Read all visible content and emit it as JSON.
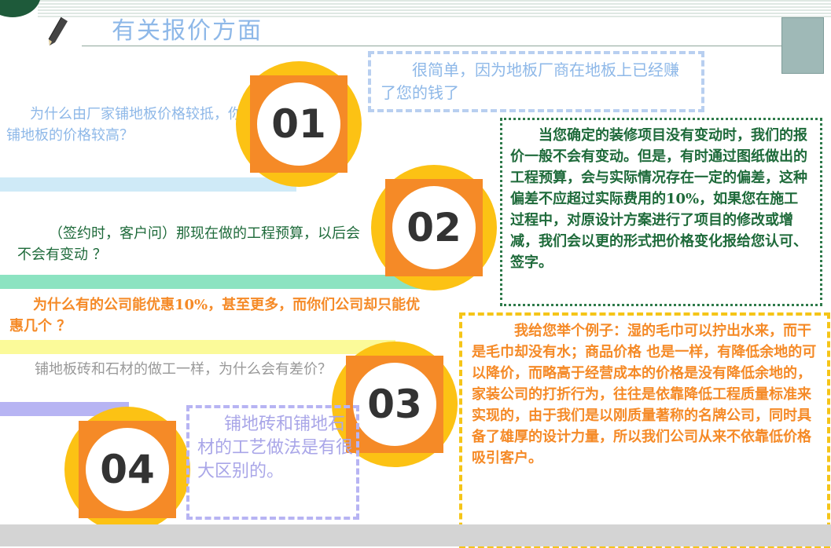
{
  "title": "有关报价方面",
  "items": [
    {
      "number": "01",
      "question": "为什么由厂家铺地板价格较抵，你们铺地板的价格较高？",
      "answer": "很简单，因为地板厂商在地板上已经赚了您的钱了"
    },
    {
      "number": "02",
      "question": "（签约时，客户问）那现在做的工程预算，以后会不会有变动 ？",
      "answer": "当您确定的装修项目没有变动时，我们的报价一般不会有变动。但是，有时通过图纸做出的工程预算，会与实际情况存在一定的偏差，这种偏差不应超过实际费用的10%，如果您在施工过程中，对原设计方案进行了项目的修改或增减，我们会以更的形式把价格变化报给您认可、签字。"
    },
    {
      "number": "03",
      "question": "为什么有的公司能优惠10%，甚至更多，而你们公司却只能优惠几个 ？",
      "answer": "我给您举个例子：湿的毛巾可以拧出水来，而干是毛巾却没有水；商品价格 也是一样，有降低余地的可以降价，而略高于经营成本的价格是没有降低余地的，家装公司的打折行为，往往是依靠降低工程质量标准来实现的，由于我们是以刚质量著称的名牌公司，同时具备了雄厚的设计力量，所以我们公司从来不依靠低价格吸引客户。"
    },
    {
      "number": "04",
      "question": "铺地板砖和石材的做工一样，为什么会有差价？",
      "answer": "铺地砖和铺地石材的工艺做法是有很大区别的。"
    }
  ],
  "colors": {
    "title": "#8eb8e8",
    "q1": "#8eb8e8",
    "q2": "#1e6a3a",
    "q3": "#f58a27",
    "q4": "#999999",
    "bar1": "#cfeaf7",
    "bar2": "#8ce3c1",
    "bar3": "#fbfa99",
    "bar4": "#b7b4f3",
    "circle_outer": "#fcc214",
    "circle_square": "#f58a27"
  }
}
